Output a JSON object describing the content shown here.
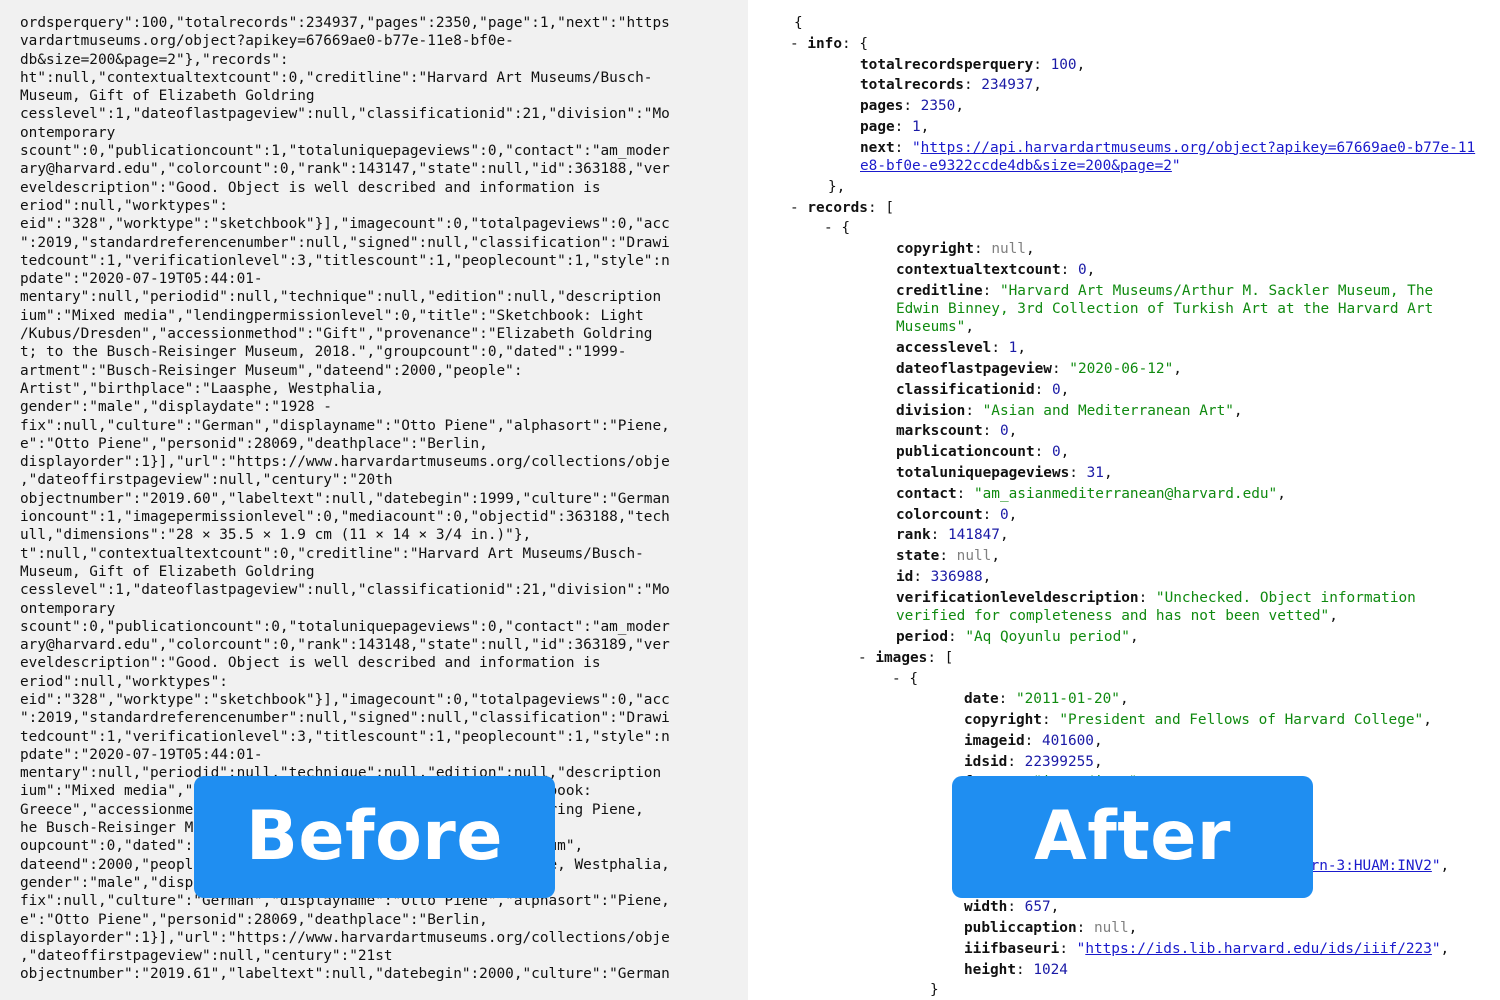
{
  "before_panel": {
    "lines": [
      "ordsperquery\":100,\"totalrecords\":234937,\"pages\":2350,\"page\":1,\"next\":\"https",
      "vardartmuseums.org/object?apikey=67669ae0-b77e-11e8-bf0e-",
      "db&size=200&page=2\"},\"records\":",
      "ht\":null,\"contextualtextcount\":0,\"creditline\":\"Harvard Art Museums/Busch-",
      "Museum, Gift of Elizabeth Goldring",
      "cesslevel\":1,\"dateoflastpageview\":null,\"classificationid\":21,\"division\":\"Mo",
      "ontemporary",
      "scount\":0,\"publicationcount\":1,\"totaluniquepageviews\":0,\"contact\":\"am_moder",
      "ary@harvard.edu\",\"colorcount\":0,\"rank\":143147,\"state\":null,\"id\":363188,\"ver",
      "eveldescription\":\"Good. Object is well described and information is",
      "eriod\":null,\"worktypes\":",
      "eid\":\"328\",\"worktype\":\"sketchbook\"}],\"imagecount\":0,\"totalpageviews\":0,\"acc",
      "\":2019,\"standardreferencenumber\":null,\"signed\":null,\"classification\":\"Drawi",
      "tedcount\":1,\"verificationlevel\":3,\"titlescount\":1,\"peoplecount\":1,\"style\":n",
      "pdate\":\"2020-07-19T05:44:01-",
      "mentary\":null,\"periodid\":null,\"technique\":null,\"edition\":null,\"description",
      "ium\":\"Mixed media\",\"lendingpermissionlevel\":0,\"title\":\"Sketchbook: Light",
      "/Kubus/Dresden\",\"accessionmethod\":\"Gift\",\"provenance\":\"Elizabeth Goldring",
      "t; to the Busch-Reisinger Museum, 2018.\",\"groupcount\":0,\"dated\":\"1999-",
      "artment\":\"Busch-Reisinger Museum\",\"dateend\":2000,\"people\":",
      "Artist\",\"birthplace\":\"Laasphe, Westphalia,",
      "gender\":\"male\",\"displaydate\":\"1928 -",
      "fix\":null,\"culture\":\"German\",\"displayname\":\"Otto Piene\",\"alphasort\":\"Piene,",
      "e\":\"Otto Piene\",\"personid\":28069,\"deathplace\":\"Berlin,",
      "displayorder\":1}],\"url\":\"https://www.harvardartmuseums.org/collections/obje",
      ",\"dateoffirstpageview\":null,\"century\":\"20th",
      "objectnumber\":\"2019.60\",\"labeltext\":null,\"datebegin\":1999,\"culture\":\"German",
      "ioncount\":1,\"imagepermissionlevel\":0,\"mediacount\":0,\"objectid\":363188,\"tech",
      "ull,\"dimensions\":\"28 × 35.5 × 1.9 cm (11 × 14 × 3/4 in.)\"},",
      "t\":null,\"contextualtextcount\":0,\"creditline\":\"Harvard Art Museums/Busch-",
      "Museum, Gift of Elizabeth Goldring",
      "cesslevel\":1,\"dateoflastpageview\":null,\"classificationid\":21,\"division\":\"Mo",
      "ontemporary",
      "scount\":0,\"publicationcount\":0,\"totaluniquepageviews\":0,\"contact\":\"am_moder",
      "ary@harvard.edu\",\"colorcount\":0,\"rank\":143148,\"state\":null,\"id\":363189,\"ver",
      "eveldescription\":\"Good. Object is well described and information is",
      "eriod\":null,\"worktypes\":",
      "eid\":\"328\",\"worktype\":\"sketchbook\"}],\"imagecount\":0,\"totalpageviews\":0,\"acc",
      "\":2019,\"standardreferencenumber\":null,\"signed\":null,\"classification\":\"Drawi",
      "tedcount\":1,\"verificationlevel\":3,\"titlescount\":1,\"peoplecount\":1,\"style\":n",
      "pdate\":\"2020-07-19T05:44:01-",
      "mentary\":null,\"periodid\":null,\"technique\":null,\"edition\":null,\"description",
      "ium\":\"Mixed media\",\"lendingpermissionlevel\":0,\"title\":\"Sketchbook:",
      "Greece\",\"accessionmethod\":\"Gift\",\"provenance\":\"Elizabeth Goldring Piene,",
      "he Busch-Reisinger Museum, 2018.\",\"groupcount\":0,",
      "oupcount\":0,\"dated\":\"2000\",\"department\":\"Busch-Reisinger Museum\",",
      "dateend\":2000,\"people\":[{\"role\":\"Artist\",\"birthplace\":\"Laasphe, Westphalia,",
      "gender\":\"male\",\"displaydate\":\"1928 -",
      "fix\":null,\"culture\":\"German\",\"displayname\":\"Otto Piene\",\"alphasort\":\"Piene,",
      "e\":\"Otto Piene\",\"personid\":28069,\"deathplace\":\"Berlin,",
      "displayorder\":1}],\"url\":\"https://www.harvardartmuseums.org/collections/obje",
      ",\"dateoffirstpageview\":null,\"century\":\"21st",
      "objectnumber\":\"2019.61\",\"labeltext\":null,\"datebegin\":2000,\"culture\":\"German"
    ]
  },
  "after_panel": {
    "lines": [
      {
        "toggle": "",
        "key": "",
        "open": "{"
      },
      {
        "toggle": "- ",
        "key": "info",
        "open": "{"
      },
      {
        "key": "totalrecordsperquery",
        "type": "num",
        "value": "100",
        "comma": ","
      },
      {
        "key": "totalrecords",
        "type": "num",
        "value": "234937",
        "comma": ","
      },
      {
        "key": "pages",
        "type": "num",
        "value": "2350",
        "comma": ","
      },
      {
        "key": "page",
        "type": "num",
        "value": "1",
        "comma": ","
      },
      {
        "key": "next",
        "type": "url",
        "value": "https://api.harvardartmuseums.org/object?apikey=67669ae0-b77e-11e8-bf0e-e9322ccde4db&size=200&page=2",
        "comma": ""
      },
      {
        "close": "},"
      },
      {
        "toggle": "- ",
        "key": "records",
        "open": "["
      },
      {
        "toggle": "- ",
        "key": "",
        "open": "{"
      },
      {
        "key": "copyright",
        "type": "nul",
        "value": "null",
        "comma": ","
      },
      {
        "key": "contextualtextcount",
        "type": "num",
        "value": "0",
        "comma": ","
      },
      {
        "key": "creditline",
        "type": "str",
        "value": "Harvard Art Museums/Arthur M. Sackler Museum, The Edwin Binney, 3rd Collection of Turkish Art at the Harvard Art Museums",
        "comma": ","
      },
      {
        "key": "accesslevel",
        "type": "num",
        "value": "1",
        "comma": ","
      },
      {
        "key": "dateoflastpageview",
        "type": "str",
        "value": "2020-06-12",
        "comma": ","
      },
      {
        "key": "classificationid",
        "type": "num",
        "value": "0",
        "comma": ","
      },
      {
        "key": "division",
        "type": "str",
        "value": "Asian and Mediterranean Art",
        "comma": ","
      },
      {
        "key": "markscount",
        "type": "num",
        "value": "0",
        "comma": ","
      },
      {
        "key": "publicationcount",
        "type": "num",
        "value": "0",
        "comma": ","
      },
      {
        "key": "totaluniquepageviews",
        "type": "num",
        "value": "31",
        "comma": ","
      },
      {
        "key": "contact",
        "type": "str",
        "value": "am_asianmediterranean@harvard.edu",
        "comma": ","
      },
      {
        "key": "colorcount",
        "type": "num",
        "value": "0",
        "comma": ","
      },
      {
        "key": "rank",
        "type": "num",
        "value": "141847",
        "comma": ","
      },
      {
        "key": "state",
        "type": "nul",
        "value": "null",
        "comma": ","
      },
      {
        "key": "id",
        "type": "num",
        "value": "336988",
        "comma": ","
      },
      {
        "key": "verificationleveldescription",
        "type": "str",
        "value": "Unchecked. Object information verified for completeness and has not been vetted",
        "comma": ","
      },
      {
        "key": "period",
        "type": "str",
        "value": "Aq Qoyunlu period",
        "comma": ","
      },
      {
        "toggle": "- ",
        "key": "images",
        "open": "["
      },
      {
        "toggle": "- ",
        "key": "",
        "open": "{"
      },
      {
        "key": "date",
        "type": "str",
        "value": "2011-01-20",
        "comma": ","
      },
      {
        "key": "copyright",
        "type": "str",
        "value": "President and Fellows of Harvard College",
        "comma": ","
      },
      {
        "key": "imageid",
        "type": "num",
        "value": "401600",
        "comma": ","
      },
      {
        "key": "idsid",
        "type": "num",
        "value": "22399255",
        "comma": ","
      },
      {
        "key": "format",
        "type": "str",
        "value": "image/jpeg",
        "comma": ","
      },
      {
        "key": "description",
        "type": "nul",
        "value": "null",
        "comma": ","
      },
      {
        "key": "",
        "type": "blank",
        "value": "",
        "comma": ""
      },
      {
        "key": "",
        "type": "blank",
        "value": "",
        "comma": ""
      },
      {
        "key": "baseimageurl",
        "type": "url",
        "value": "https://nrs.harvard.edu/urn-3:HUAM:INV2",
        "comma": ","
      },
      {
        "key": "",
        "type": "blank",
        "value": "",
        "comma": ""
      },
      {
        "key": "width",
        "type": "num",
        "value": "657",
        "comma": ","
      },
      {
        "key": "publiccaption",
        "type": "nul",
        "value": "null",
        "comma": ","
      },
      {
        "key": "iiifbaseuri",
        "type": "url",
        "value": "https://ids.lib.harvard.edu/ids/iiif/223",
        "comma": ","
      },
      {
        "key": "height",
        "type": "num",
        "value": "1024",
        "comma": ""
      },
      {
        "close": "}"
      }
    ]
  },
  "badges": {
    "before": "Before",
    "after": "After"
  },
  "colors": {
    "badge_bg": "#1f8ef1",
    "left_bg": "#f1f1f1",
    "number": "#1a1aa6",
    "string": "#108a10",
    "null": "#808080",
    "link": "#1a1acc"
  }
}
